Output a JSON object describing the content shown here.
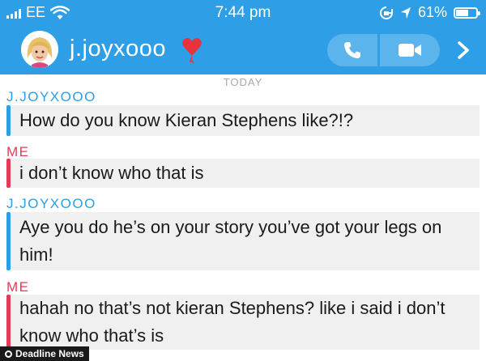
{
  "status_bar": {
    "carrier": "EE",
    "time": "7:44 pm",
    "battery_percent": "61%",
    "battery_level": 0.61,
    "icons": [
      "signal-bars-icon",
      "wifi-icon",
      "screen-lock-icon",
      "location-arrow-icon",
      "battery-icon"
    ]
  },
  "header": {
    "username": "j.joyxooo",
    "icons": [
      "avatar-bitmoji",
      "heart-icon",
      "phone-icon",
      "video-camera-icon",
      "chevron-right-icon"
    ],
    "accent_color": "#2e9fe6"
  },
  "chat": {
    "date_divider": "TODAY",
    "colors": {
      "them": "#2c9ee5",
      "me": "#e53a56"
    },
    "messages": [
      {
        "sender": "J.JOYXOOO",
        "from": "them",
        "text": "How do you know Kieran Stephens like?!?"
      },
      {
        "sender": "ME",
        "from": "me",
        "text": "i don’t know who that is"
      },
      {
        "sender": "J.JOYXOOO",
        "from": "them",
        "text": "Aye you do he’s on your story you’ve got your legs on him!"
      },
      {
        "sender": "ME",
        "from": "me",
        "text": "hahah no that’s not kieran Stephens? like i said i don’t know who that’s is"
      }
    ]
  },
  "watermark": {
    "text": "Deadline News"
  }
}
